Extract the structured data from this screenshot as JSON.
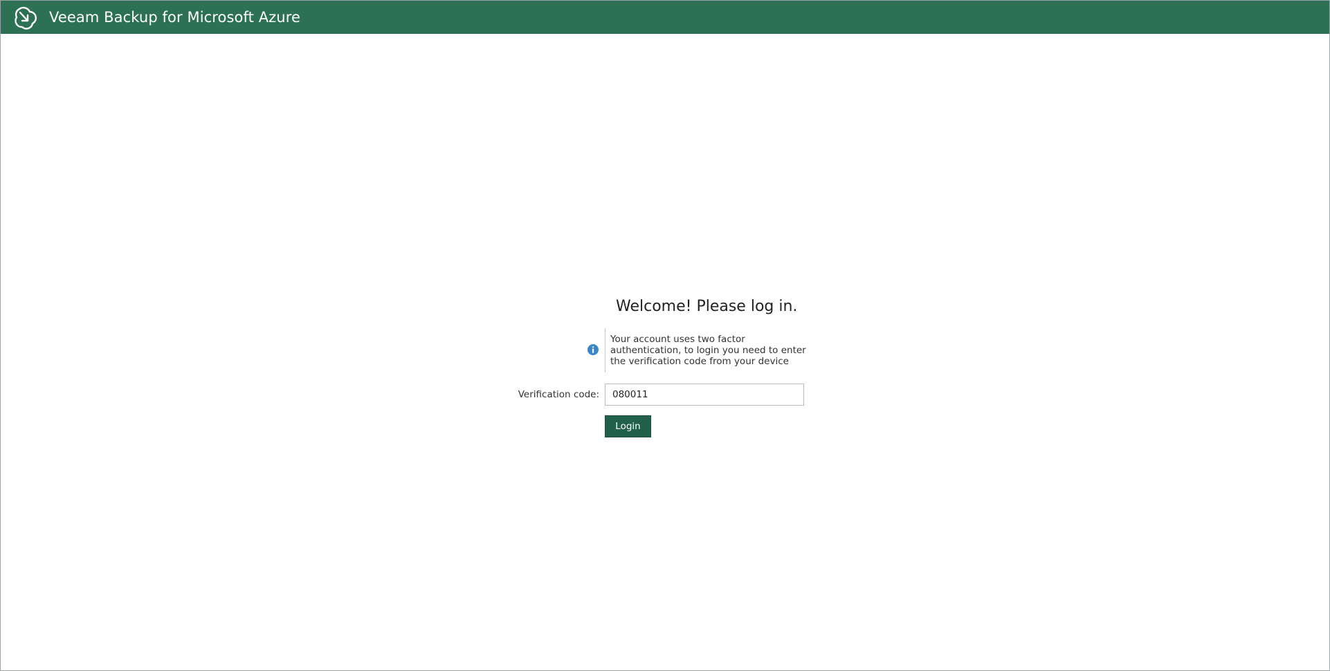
{
  "header": {
    "title": "Veeam Backup for Microsoft Azure",
    "logo_icon": "veeam-cloud-logo-icon",
    "background_color": "#2d7155"
  },
  "login": {
    "heading": "Welcome! Please log in.",
    "info": {
      "icon": "info-icon",
      "icon_color": "#3b86c6",
      "text": "Your account uses two factor authentication, to login you need to enter the verification code from your device"
    },
    "verification": {
      "label": "Verification code:",
      "value": "080011"
    },
    "submit_label": "Login",
    "button_color": "#22604a"
  }
}
